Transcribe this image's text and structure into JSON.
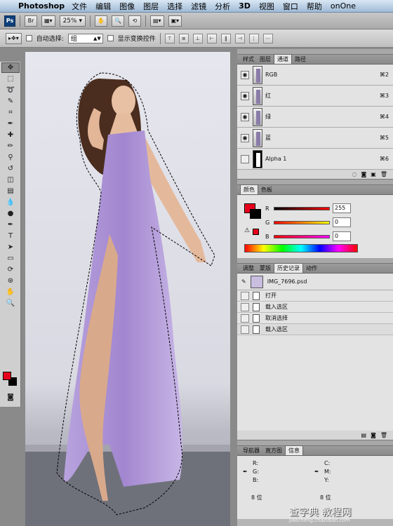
{
  "menubar": {
    "app": "Photoshop",
    "items": [
      "文件",
      "编辑",
      "图像",
      "图层",
      "选择",
      "滤镜",
      "分析",
      "3D",
      "视图",
      "窗口",
      "帮助"
    ],
    "plugin": "onOne"
  },
  "appbar": {
    "ps": "Ps",
    "bridge": "Br",
    "zoom": "25%"
  },
  "options": {
    "auto_select_label": "自动选择:",
    "auto_select_value": "组",
    "show_transform_label": "显示变换控件"
  },
  "channels_panel": {
    "tabs": [
      "样式",
      "图层",
      "通道",
      "路径"
    ],
    "active_tab": "通道",
    "channels": [
      {
        "name": "RGB",
        "key": "⌘2"
      },
      {
        "name": "红",
        "key": "⌘3"
      },
      {
        "name": "绿",
        "key": "⌘4"
      },
      {
        "name": "蓝",
        "key": "⌘5"
      },
      {
        "name": "Alpha 1",
        "key": "⌘6"
      }
    ]
  },
  "color_panel": {
    "tabs": [
      "颜色",
      "色板"
    ],
    "active_tab": "颜色",
    "r": "255",
    "g": "0",
    "b": "0",
    "r_label": "R",
    "g_label": "G",
    "b_label": "B"
  },
  "history_panel": {
    "tabs": [
      "调整",
      "蒙版",
      "历史记录",
      "动作"
    ],
    "active_tab": "历史记录",
    "snapshot": "IMG_7696.psd",
    "steps": [
      "打开",
      "载入选区",
      "取消选择",
      "载入选区"
    ]
  },
  "info_panel": {
    "tabs": [
      "导航器",
      "直方图",
      "信息"
    ],
    "active_tab": "信息",
    "r": "R:",
    "g": "G:",
    "b": "B:",
    "c": "C:",
    "m": "M:",
    "y": "Y:",
    "bits_left": "8 位",
    "bits_right": "8 位"
  },
  "colors": {
    "foreground": "#e8001c",
    "background": "#000000",
    "dress": "#a88fd0"
  },
  "watermark": {
    "main": "查字典 教程网",
    "sub": "jiaocheng.chazidian.com"
  }
}
